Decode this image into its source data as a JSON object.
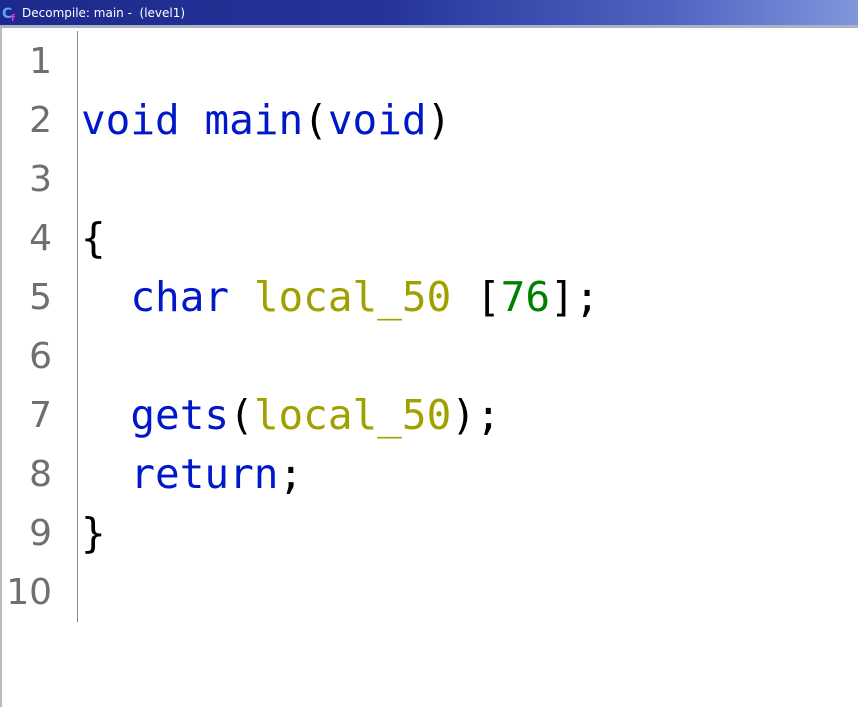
{
  "window": {
    "title": "Decompile: main -  (level1)",
    "icon": "decompiler-cf-icon"
  },
  "colors": {
    "keyword": "#0018c8",
    "function": "#0018c8",
    "variable": "#a0a000",
    "number": "#008000",
    "punctuation": "#000000",
    "line_number": "#6f6f6f"
  },
  "editor": {
    "lines": [
      {
        "number": "1",
        "tokens": []
      },
      {
        "number": "2",
        "tokens": [
          {
            "text": "void",
            "type": "kw"
          },
          {
            "text": " ",
            "type": "pun"
          },
          {
            "text": "main",
            "type": "fn"
          },
          {
            "text": "(",
            "type": "pun"
          },
          {
            "text": "void",
            "type": "kw"
          },
          {
            "text": ")",
            "type": "pun"
          }
        ]
      },
      {
        "number": "3",
        "tokens": []
      },
      {
        "number": "4",
        "tokens": [
          {
            "text": "{",
            "type": "pun"
          }
        ]
      },
      {
        "number": "5",
        "tokens": [
          {
            "text": "  ",
            "type": "pun"
          },
          {
            "text": "char",
            "type": "kw"
          },
          {
            "text": " ",
            "type": "pun"
          },
          {
            "text": "local_50",
            "type": "var"
          },
          {
            "text": " [",
            "type": "pun"
          },
          {
            "text": "76",
            "type": "num"
          },
          {
            "text": "];",
            "type": "pun"
          }
        ]
      },
      {
        "number": "6",
        "tokens": []
      },
      {
        "number": "7",
        "tokens": [
          {
            "text": "  ",
            "type": "pun"
          },
          {
            "text": "gets",
            "type": "fn"
          },
          {
            "text": "(",
            "type": "pun"
          },
          {
            "text": "local_50",
            "type": "var"
          },
          {
            "text": ");",
            "type": "pun"
          }
        ]
      },
      {
        "number": "8",
        "tokens": [
          {
            "text": "  ",
            "type": "pun"
          },
          {
            "text": "return",
            "type": "kw"
          },
          {
            "text": ";",
            "type": "pun"
          }
        ]
      },
      {
        "number": "9",
        "tokens": [
          {
            "text": "}",
            "type": "pun"
          }
        ]
      },
      {
        "number": "10",
        "tokens": []
      }
    ]
  }
}
